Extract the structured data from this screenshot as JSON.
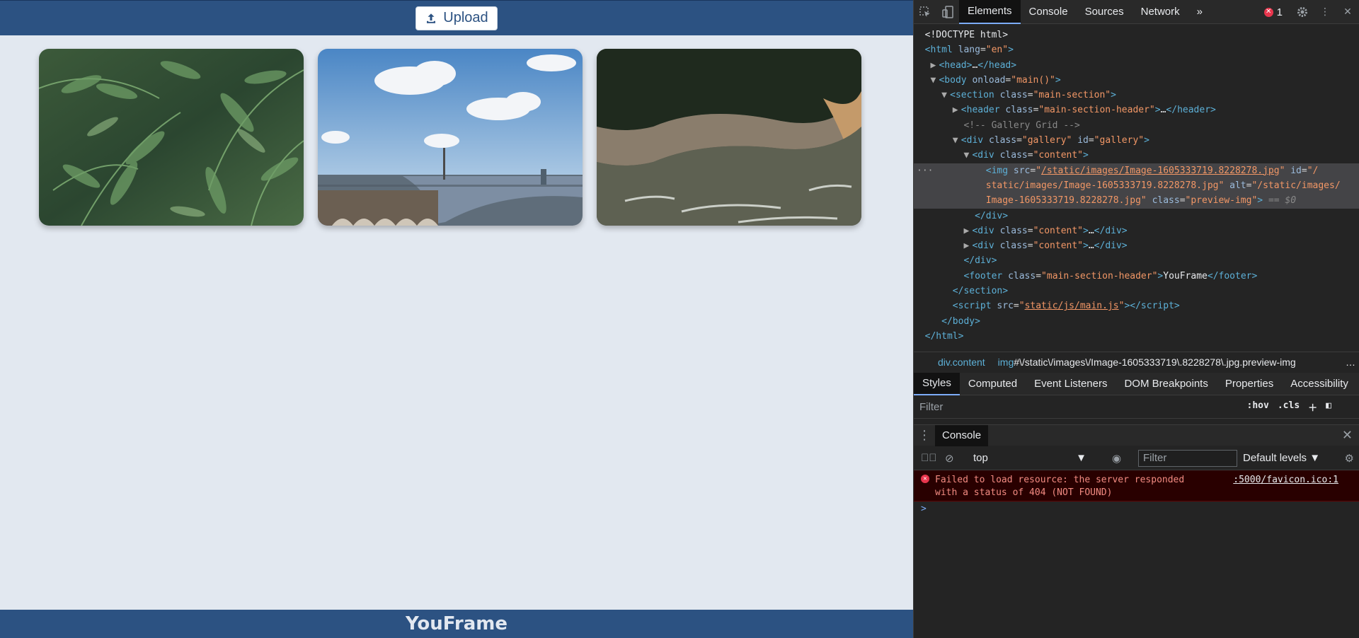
{
  "app": {
    "upload_label": "Upload",
    "footer_title": "YouFrame",
    "gallery": [
      {
        "alt": "fern leaves photo"
      },
      {
        "alt": "city river skyline photo"
      },
      {
        "alt": "aerial coastline photo"
      }
    ]
  },
  "devtools": {
    "tabs": [
      "Elements",
      "Console",
      "Sources",
      "Network"
    ],
    "more_tabs": "»",
    "error_count": "1",
    "breadcrumbs": {
      "first": "div.content",
      "second_tag": "img",
      "second_rest": "#\\/static\\/images\\/Image-1605333719\\.8228278\\.jpg.preview-img",
      "more": "…"
    },
    "subtabs": [
      "Styles",
      "Computed",
      "Event Listeners",
      "DOM Breakpoints",
      "Properties",
      "Accessibility"
    ],
    "styles_filter_placeholder": "Filter",
    "hov": ":hov",
    "cls": ".cls",
    "drawer_tab": "Console",
    "console_context": "top",
    "console_filter_placeholder": "Filter",
    "console_levels": "Default levels",
    "error_message_1": "Failed to load resource: the server responded",
    "error_message_2": "with a status of 404 (NOT FOUND)",
    "error_source": ":5000/favicon.ico:1",
    "prompt": ">"
  },
  "colors": {
    "header": "#2c5282",
    "page_bg": "#e2e8f0",
    "devtools_bg": "#242424"
  }
}
